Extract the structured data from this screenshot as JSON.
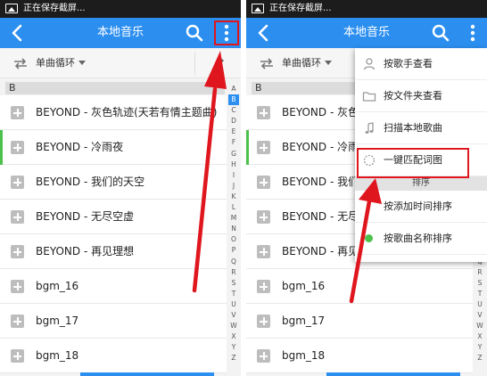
{
  "status_bar": {
    "text": "正在保存截屏..."
  },
  "app_bar": {
    "title": "本地音乐"
  },
  "toolbar": {
    "play_mode": "单曲循环"
  },
  "section": {
    "letter": "B"
  },
  "songs": [
    {
      "title": "BEYOND - 灰色轨迹(天若有情主题曲)",
      "truncated": "BEYOND - 灰色轨"
    },
    {
      "title": "BEYOND - 冷雨夜",
      "truncated": "BEYOND - 冷雨夜"
    },
    {
      "title": "BEYOND - 我们的天空",
      "truncated": "BEYOND - 我们的"
    },
    {
      "title": "BEYOND - 无尽空虚",
      "truncated": "BEYOND - 无尽空"
    },
    {
      "title": "BEYOND - 再见理想",
      "truncated": "BEYOND - 再见理"
    },
    {
      "title": "bgm_16",
      "truncated": "bgm_16"
    },
    {
      "title": "bgm_17",
      "truncated": "bgm_17"
    },
    {
      "title": "bgm_18",
      "truncated": "bgm_18"
    }
  ],
  "alpha_index": [
    "A",
    "B",
    "C",
    "D",
    "E",
    "F",
    "G",
    "H",
    "I",
    "J",
    "K",
    "L",
    "M",
    "N",
    "O",
    "P",
    "Q",
    "R",
    "S",
    "T",
    "U",
    "V",
    "W",
    "X",
    "Y",
    "Z"
  ],
  "menu": {
    "items": [
      {
        "label": "按歌手查看",
        "icon": "person-icon"
      },
      {
        "label": "按文件夹查看",
        "icon": "folder-icon"
      },
      {
        "label": "扫描本地歌曲",
        "icon": "music-note-icon"
      },
      {
        "label": "一键匹配词图",
        "icon": "match-icon"
      }
    ],
    "section_label": "排序",
    "sort_items": [
      {
        "label": "按添加时间排序"
      },
      {
        "label": "按歌曲名称排序"
      }
    ]
  },
  "colors": {
    "app_bar": "#2c8ff0",
    "highlight": "#e0161e",
    "active_indicator": "#4cc24c",
    "status_bar": "#1c1c1c"
  }
}
